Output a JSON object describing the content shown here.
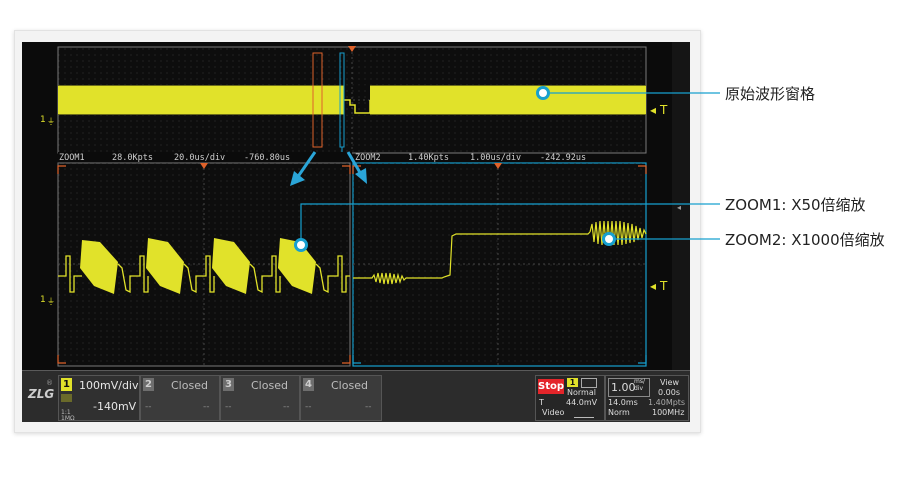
{
  "scope": {
    "overview_ground_label": "1",
    "overview_trigger_label": "T",
    "zoom1_bar": {
      "name": "ZOOM1",
      "points": "28.0Kpts",
      "scale": "20.0us/div",
      "offset": "-760.80us"
    },
    "zoom2_bar": {
      "name": "ZOOM2",
      "points": "1.40Kpts",
      "scale": "1.00us/div",
      "offset": "-242.92us"
    },
    "zoom_ground_label": "1",
    "zoom_trigger_label": "T"
  },
  "status": {
    "logo": "ZLG",
    "ch1": {
      "num": "1",
      "scale": "100mV/div",
      "offset": "-140mV",
      "coupling": "1:1",
      "impedance": "1MΩ"
    },
    "ch2": {
      "num": "2",
      "state": "Closed",
      "dash": "--"
    },
    "ch3": {
      "num": "3",
      "state": "Closed",
      "dash": "--"
    },
    "ch4": {
      "num": "4",
      "state": "Closed",
      "dash": "--"
    },
    "run": "Stop",
    "trig_ch": "1",
    "trig_mode": "Normal",
    "trig_letter": "T",
    "trig_level": "44.0mV",
    "trig_type": "Video",
    "timebase": "1.00",
    "timebase_unit_top": "ms/",
    "timebase_unit_bottom": "div",
    "record": "14.0ms",
    "points": "1.40Mpts",
    "acq": "Norm",
    "rate": "100MHz",
    "view_label": "View",
    "view_value": "0.00s"
  },
  "callouts": {
    "original": "原始波形窗格",
    "zoom1": "ZOOM1: X50倍缩放",
    "zoom2": "ZOOM2: X1000倍缩放"
  },
  "colors": {
    "trace": "#e1e22a",
    "accent": "#17a0cf",
    "zoom_marker": "#e0622a",
    "stop": "#e4252a"
  }
}
